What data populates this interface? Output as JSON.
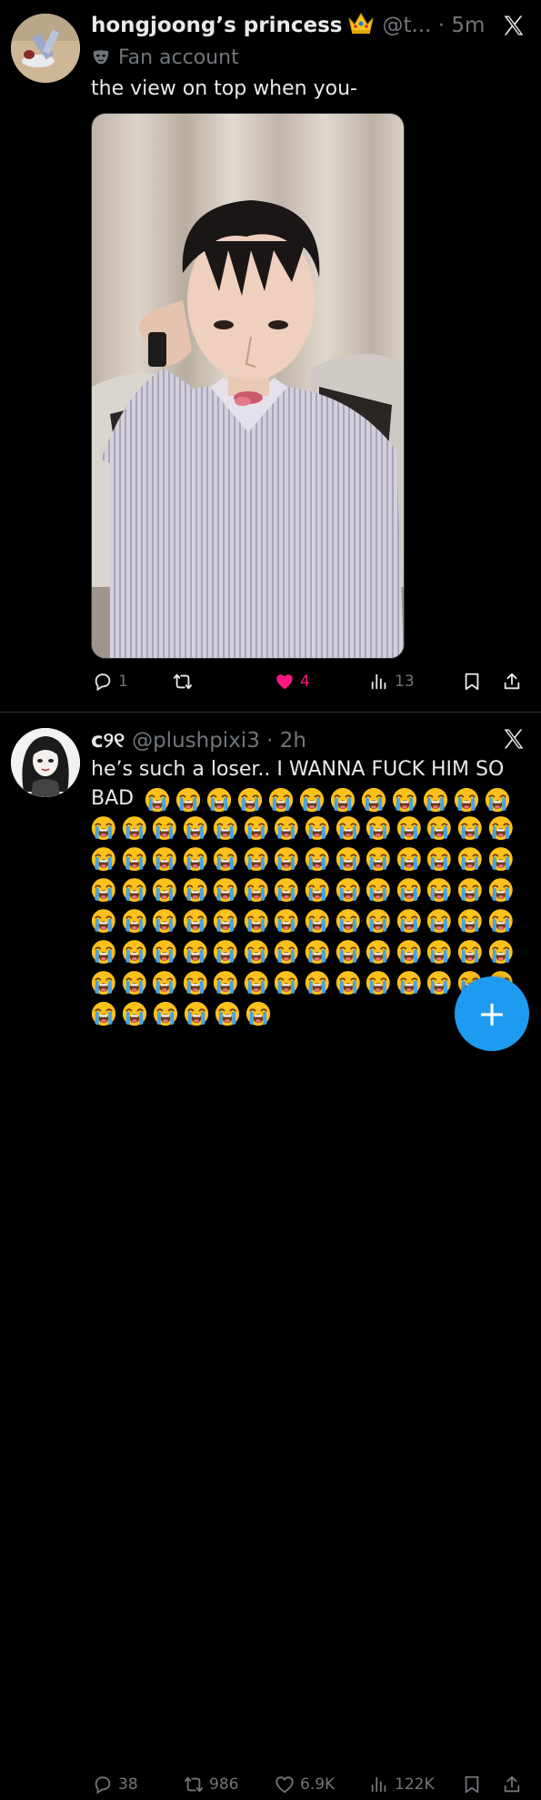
{
  "tweets": [
    {
      "display_name": "hongjoong’s princess",
      "handle": "@t... · 5m",
      "label": "Fan account",
      "text": "the view on top when you-",
      "actions": {
        "replies": "1",
        "reposts": "",
        "likes": "4",
        "views": "13"
      }
    },
    {
      "display_name": "c୨୧",
      "handle": "@plushpixi3 · 2h",
      "text_line1": "he’s such a loser.. I WANNA FUCK HIM SO",
      "text_line2": "BAD",
      "emoji_count_first_line": 12,
      "emoji_rows": 7,
      "emoji_last_row": 6,
      "actions": {
        "replies": "38",
        "reposts": "986",
        "likes": "6.9K",
        "views": "122K"
      }
    }
  ],
  "colors": {
    "accent": "#1d9bf0",
    "like": "#f91880",
    "muted": "#71767b"
  },
  "icons": [
    "x-logo-icon",
    "crown-emoji-icon",
    "mask-icon",
    "reply-icon",
    "repost-icon",
    "like-icon",
    "views-icon",
    "bookmark-icon",
    "share-icon",
    "loudly-crying-face-emoji",
    "compose-plus-icon"
  ]
}
